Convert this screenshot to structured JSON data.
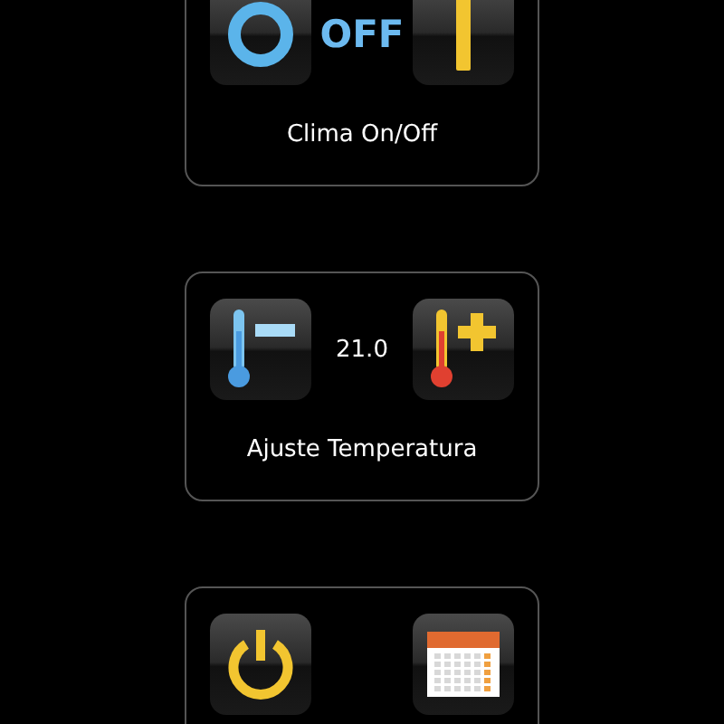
{
  "cards": [
    {
      "left": {
        "kind": "ring"
      },
      "middle": {
        "text": "OFF",
        "kind": "state"
      },
      "right": {
        "kind": "bar"
      },
      "label": "Clima On/Off"
    },
    {
      "left": {
        "kind": "thermo-minus"
      },
      "middle": {
        "text": "21.0",
        "kind": "value"
      },
      "right": {
        "kind": "thermo-plus"
      },
      "label": "Ajuste Temperatura"
    },
    {
      "left": {
        "kind": "power"
      },
      "right": {
        "kind": "calendar"
      }
    }
  ]
}
